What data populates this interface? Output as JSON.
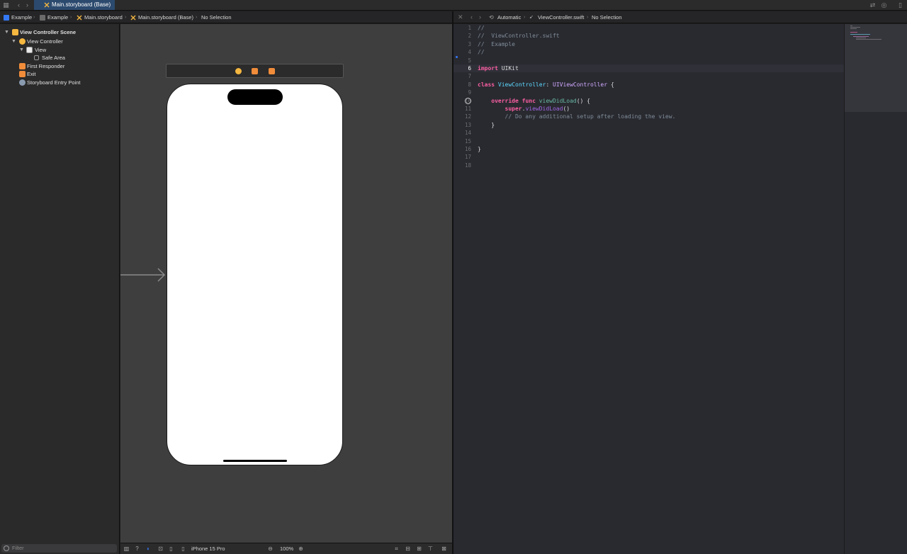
{
  "tabbar": {
    "active_tab": "Main.storyboard (Base)"
  },
  "breadcrumb_left": {
    "items": [
      "Example",
      "Example",
      "Main.storyboard",
      "Main.storyboard (Base)",
      "No Selection"
    ]
  },
  "breadcrumb_right": {
    "items": [
      "Automatic",
      "ViewController.swift",
      "No Selection"
    ]
  },
  "navigator": {
    "scene": "View Controller Scene",
    "view_controller": "View Controller",
    "view": "View",
    "safe_area": "Safe Area",
    "first_responder": "First Responder",
    "exit": "Exit",
    "entry_point": "Storyboard Entry Point",
    "filter_placeholder": "Filter"
  },
  "canvas_bottom": {
    "device": "iPhone 15 Pro",
    "zoom": "100%"
  },
  "editor": {
    "current_line": 6,
    "line_numbers": [
      "1",
      "2",
      "3",
      "4",
      "5",
      "6",
      "7",
      "8",
      "9",
      "10",
      "11",
      "12",
      "13",
      "14",
      "15",
      "16",
      "17",
      "18"
    ],
    "lines": [
      "//",
      "//  ViewController.swift",
      "//  Example",
      "//",
      "",
      "import UIKit",
      "",
      "class ViewController: UIViewController {",
      "",
      "    override func viewDidLoad() {",
      "        super.viewDidLoad()",
      "        // Do any additional setup after loading the view.",
      "    }",
      "",
      "",
      "}",
      "",
      ""
    ],
    "tokens": {
      "c1": "//",
      "c2": "//  ViewController.swift",
      "c3": "//  Example",
      "c4": "//",
      "import_kw": "import",
      "uikit": " UIKit",
      "class_kw": "class",
      "class_name": "ViewController",
      "colon": ": ",
      "super_type": "UIViewController",
      "brace_open": " {",
      "indent4": "    ",
      "override_kw": "override",
      "func_kw": "func",
      "method_name": "viewDidLoad",
      "paren_brace": "() {",
      "indent8": "        ",
      "super_kw": "super",
      "dot": ".",
      "super_call": "viewDidLoad",
      "parens": "()",
      "comment_setup": "// Do any additional setup after loading the view.",
      "close_inner": "    }",
      "close_outer": "}",
      "space": " "
    }
  },
  "colors": {
    "accent": "#3478f6",
    "tab_active": "#2c4a6e",
    "keyword": "#fc5fa3",
    "type": "#5dd8ff",
    "comment": "#7f8c98",
    "function": "#67b7a4",
    "method": "#a167e6"
  }
}
